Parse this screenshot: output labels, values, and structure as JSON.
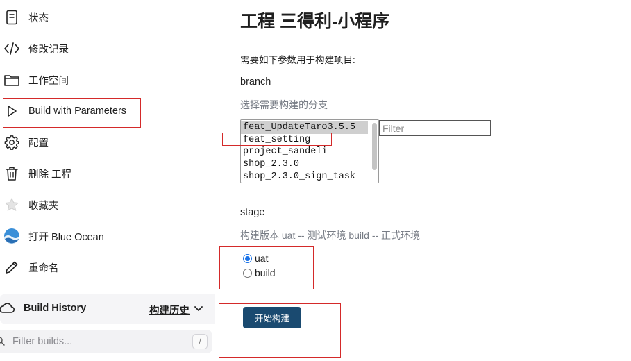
{
  "sidebar": {
    "items": [
      {
        "label": "状态",
        "icon": "document-icon"
      },
      {
        "label": "修改记录",
        "icon": "code-icon"
      },
      {
        "label": "工作空间",
        "icon": "folder-icon"
      },
      {
        "label": "Build with Parameters",
        "icon": "play-icon"
      },
      {
        "label": "配置",
        "icon": "gear-icon"
      },
      {
        "label": "删除 工程",
        "icon": "trash-icon"
      },
      {
        "label": "收藏夹",
        "icon": "star-icon"
      },
      {
        "label": "打开 Blue Ocean",
        "icon": "blue-ocean-icon"
      },
      {
        "label": "重命名",
        "icon": "pencil-icon"
      }
    ]
  },
  "build_history": {
    "title": "Build History",
    "trend_label": "构建历史",
    "filter_placeholder": "Filter builds...",
    "shortcut_key": "/"
  },
  "main": {
    "title": "工程 三得利-小程序",
    "description": "需要如下参数用于构建项目:",
    "branch": {
      "name": "branch",
      "description": "选择需要构建的分支",
      "options": [
        "feat_UpdateTaro3.5.5",
        "feat_setting",
        "project_sandeli",
        "shop_2.3.0",
        "shop_2.3.0_sign_task"
      ],
      "selected": "feat_UpdateTaro3.5.5",
      "filter_placeholder": "Filter"
    },
    "stage": {
      "name": "stage",
      "description": "构建版本 uat -- 测试环境 build -- 正式环境",
      "options": [
        "uat",
        "build"
      ],
      "selected": "uat"
    },
    "build_button": "开始构建"
  },
  "colors": {
    "annotation_red": "#d42a2a",
    "button_bg": "#1a4a70",
    "radio_blue": "#1a73e8"
  }
}
